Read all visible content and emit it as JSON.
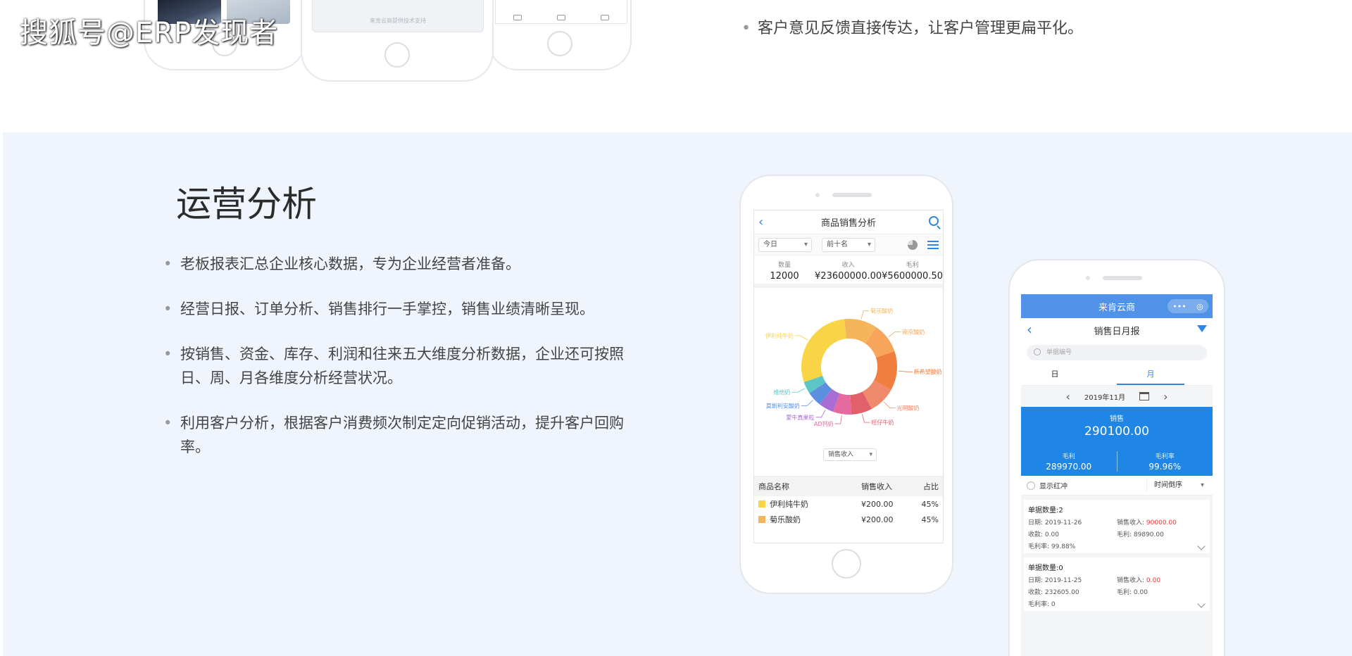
{
  "watermark": "搜狐号@ERP发现者",
  "top": {
    "phone_support_text": "来肯云商提供技术支持",
    "bullet": "客户意见反馈直接传达，让客户管理更扁平化。"
  },
  "section": {
    "title": "运营分析",
    "bullets": [
      "老板报表汇总企业核心数据，专为企业经营者准备。",
      "经营日报、订单分析、销售排行一手掌控，销售业绩清晰呈现。",
      "按销售、资金、库存、利润和往来五大维度分析数据，企业还可按照日、周、月各维度分析经营状况。",
      "利用客户分析，根据客户消费频次制定定向促销活动，提升客户回购率。"
    ]
  },
  "phone1": {
    "title": "商品销售分析",
    "filter_period": "今日",
    "filter_rank": "前十名",
    "stats": [
      {
        "label": "数量",
        "value": "12000"
      },
      {
        "label": "收入",
        "value": "¥23600000.00"
      },
      {
        "label": "毛利",
        "value": "¥5600000.50"
      }
    ],
    "mode_select": "销售收入",
    "table_headers": {
      "name": "商品名称",
      "revenue": "销售收入",
      "pct": "占比"
    },
    "table_rows": [
      {
        "name": "伊利纯牛奶",
        "revenue": "¥200.00",
        "pct": "45%",
        "color": "#f9d447"
      },
      {
        "name": "菊乐酸奶",
        "revenue": "¥200.00",
        "pct": "45%",
        "color": "#f5b55a"
      }
    ]
  },
  "chart_data": {
    "type": "pie",
    "donut": true,
    "values": [
      28,
      11,
      10,
      13,
      9,
      7,
      6,
      5,
      5,
      4
    ],
    "colors": [
      "#f9d447",
      "#f5b55a",
      "#f6a55a",
      "#f07e3e",
      "#ef8a6d",
      "#e2606a",
      "#e56aa0",
      "#a86ed6",
      "#5c8fe0",
      "#5cc6c6"
    ],
    "labels": [
      "伊利纯牛奶",
      "菊乐酸奶",
      "南京酸奶",
      "新希望酸奶",
      "光明酸奶",
      "旺仔牛奶",
      "AD钙奶",
      "蒙牛真果粒",
      "莫斯利安酸奶",
      "维他奶"
    ]
  },
  "phone2": {
    "app_name": "来肯云商",
    "pill_more": "•••",
    "pill_target": "◎",
    "title": "销售日月报",
    "search_placeholder": "单据编号",
    "tab_day": "日",
    "tab_month": "月",
    "date": "2019年11月",
    "sales_label": "销售",
    "sales_value": "290100.00",
    "profit_label": "毛利",
    "profit_value": "289970.00",
    "margin_label": "毛利率",
    "margin_value": "99.96%",
    "show_red": "显示红冲",
    "sort": "时间倒序",
    "cards": [
      {
        "header": "单据数量:2",
        "date": "日期:  2019-11-26",
        "revenue_label": "销售收入:",
        "revenue": "90000.00",
        "receipt": "收款:  0.00",
        "profit": "毛利:  89890.00",
        "margin": "毛利率:  99.88%"
      },
      {
        "header": "单据数量:0",
        "date": "日期:  2019-11-25",
        "revenue_label": "销售收入:",
        "revenue": "0.00",
        "receipt": "收款:  232605.00",
        "profit": "毛利:  0.00",
        "margin": "毛利率:  0"
      }
    ]
  }
}
